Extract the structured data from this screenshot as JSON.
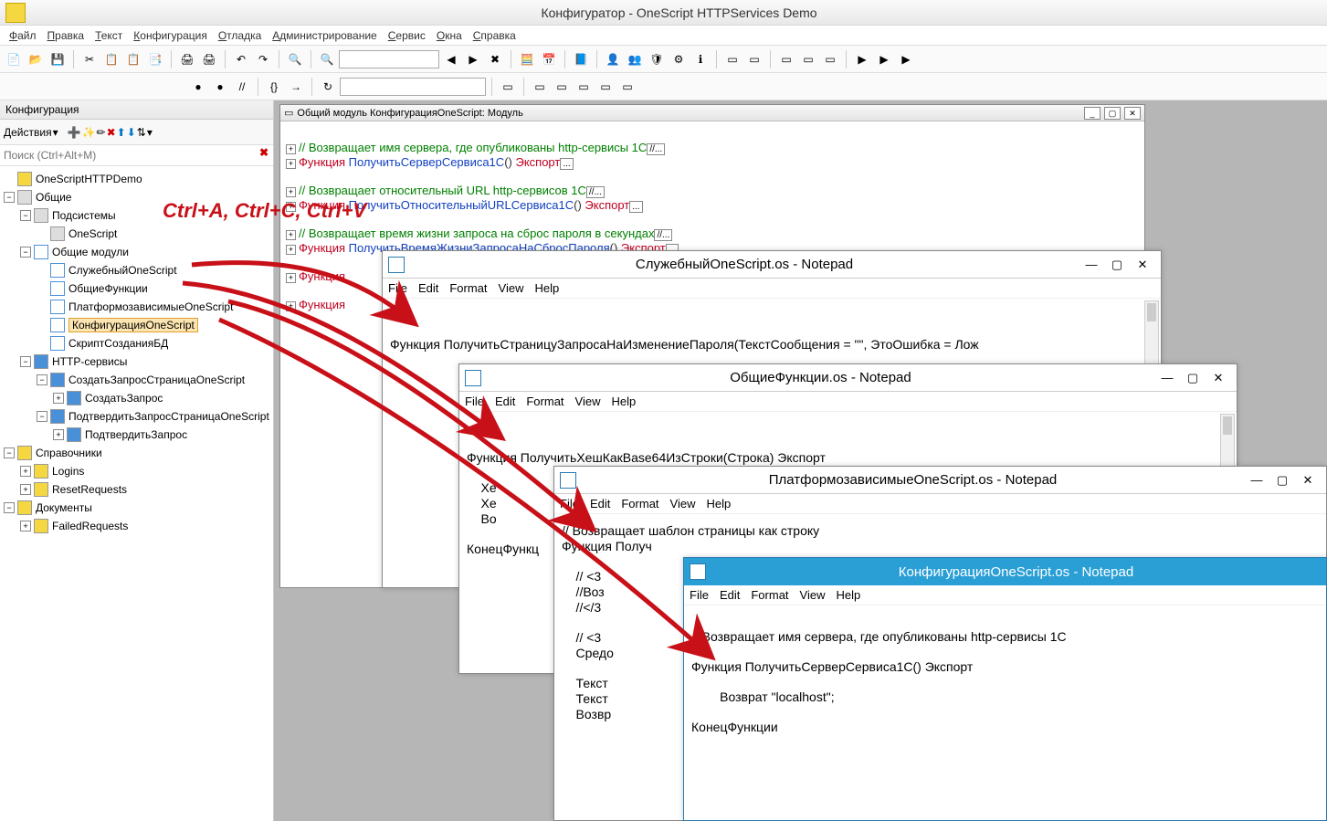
{
  "app": {
    "title": "Конфигуратор - OneScript HTTPServices Demo"
  },
  "menu": {
    "items": [
      "Файл",
      "Правка",
      "Текст",
      "Конфигурация",
      "Отладка",
      "Администрирование",
      "Сервис",
      "Окна",
      "Справка"
    ]
  },
  "sidebar": {
    "title": "Конфигурация",
    "actions_label": "Действия",
    "search_placeholder": "Поиск (Ctrl+Alt+M)"
  },
  "tree": {
    "r0": "OneScriptHTTPDemo",
    "r1": "Общие",
    "r2": "Подсистемы",
    "r3": "OneScript",
    "r4": "Общие модули",
    "r5": "СлужебныйOneScript",
    "r6": "ОбщиеФункции",
    "r7": "ПлатформозависимыеOneScript",
    "r8": "КонфигурацияOneScript",
    "r9": "СкриптСозданияБД",
    "r10": "HTTP-сервисы",
    "r11": "СоздатьЗапросСтраницаOneScript",
    "r12": "СоздатьЗапрос",
    "r13": "ПодтвердитьЗапросСтраницаOneScript",
    "r14": "ПодтвердитьЗапрос",
    "r15": "Справочники",
    "r16": "Logins",
    "r17": "ResetRequests",
    "r18": "Документы",
    "r19": "FailedRequests"
  },
  "code_win": {
    "title": "Общий модуль КонфигурацияOneScript: Модуль",
    "l1c": "// Возвращает имя сервера, где опубликованы http-сервисы 1С",
    "l1e": "//...",
    "l2k": "Функция ",
    "l2n": "ПолучитьСерверСервиса1С",
    "l2p": "()",
    "l2e": " Экспорт",
    "l3c": "// Возвращает относительный URL http-сервисов 1С",
    "l3e": "//...",
    "l4k": "Функция ",
    "l4n": "ПолучитьОтносительныйURLСервиса1С",
    "l4p": "()",
    "l4e": " Экспорт",
    "l5c": "// Возвращает время жизни запроса на сброс пароля в секундах",
    "l5e": "//...",
    "l6k": "Функция ",
    "l6n": "ПолучитьВремяЖизниЗапросаНаСбросПароля",
    "l6p": "()",
    "l6e": " Экспорт",
    "l7k": "Функция",
    "l8k": "Функция"
  },
  "np_menu": {
    "file": "File",
    "edit": "Edit",
    "format": "Format",
    "view": "View",
    "help": "Help"
  },
  "np1": {
    "title": "СлужебныйOneScript.os - Notepad",
    "body": "Функция ПолучитьСтраницуЗапросаНаИзменениеПароля(ТекстСообщения = \"\", ЭтоОшибка = Лож"
  },
  "np2": {
    "title": "ОбщиеФункции.os - Notepad",
    "b1": "Функция ПолучитьХешКакBase64ИзСтроки(Строка) Экспорт",
    "b2": "    Хе",
    "b3": "    Хе",
    "b4": "    Во",
    "b5": "КонецФункц"
  },
  "np3": {
    "title": "ПлатформозависимыеOneScript.os - Notepad",
    "b1": "// Возвращает шаблон страницы как строку",
    "b2": "Функция Получ",
    "b3": "    // <3",
    "b4": "    //Воз",
    "b5": "    //</3",
    "b6": "    // <3",
    "b7": "    Средо",
    "b8": "    Текст",
    "b9": "    Текст",
    "b10": "    Возвр"
  },
  "np4": {
    "title": "КонфигурацияOneScript.os - Notepad",
    "b1": "// Возвращает имя сервера, где опубликованы http-сервисы 1С",
    "b2": "Функция ПолучитьСерверСервиса1С() Экспорт",
    "b3": "        Возврат \"localhost\";",
    "b4": "КонецФункции"
  },
  "annotation": {
    "text": "Ctrl+A, Ctrl+C, Ctrl+V"
  }
}
